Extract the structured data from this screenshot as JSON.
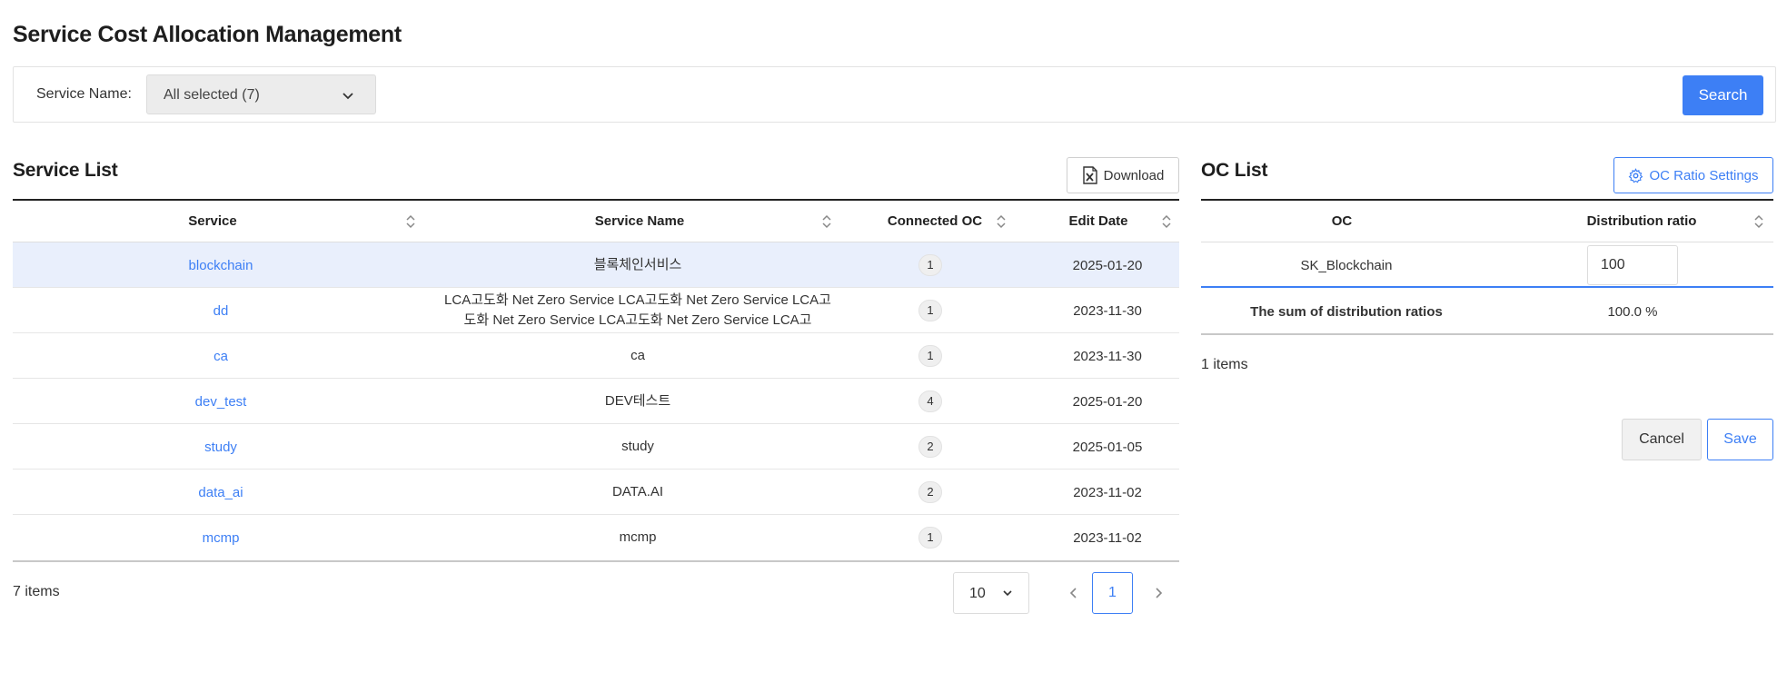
{
  "page": {
    "title": "Service Cost Allocation Management"
  },
  "filter": {
    "label": "Service Name:",
    "selected_value": "All selected (7)",
    "search_label": "Search"
  },
  "service_list": {
    "title": "Service List",
    "download_label": "Download",
    "columns": [
      "Service",
      "Service Name",
      "Connected OC",
      "Edit Date"
    ],
    "rows": [
      {
        "service": "blockchain",
        "name": "블록체인서비스",
        "connected_oc": "1",
        "edit_date": "2025-01-20",
        "selected": true
      },
      {
        "service": "dd",
        "name": "LCA고도화 Net Zero Service LCA고도화 Net Zero Service LCA고도화 Net Zero Service LCA고도화 Net Zero Service LCA고",
        "connected_oc": "1",
        "edit_date": "2023-11-30",
        "selected": false
      },
      {
        "service": "ca",
        "name": "ca",
        "connected_oc": "1",
        "edit_date": "2023-11-30",
        "selected": false
      },
      {
        "service": "dev_test",
        "name": "DEV테스트",
        "connected_oc": "4",
        "edit_date": "2025-01-20",
        "selected": false
      },
      {
        "service": "study",
        "name": "study",
        "connected_oc": "2",
        "edit_date": "2025-01-05",
        "selected": false
      },
      {
        "service": "data_ai",
        "name": "DATA.AI",
        "connected_oc": "2",
        "edit_date": "2023-11-02",
        "selected": false
      },
      {
        "service": "mcmp",
        "name": "mcmp",
        "connected_oc": "1",
        "edit_date": "2023-11-02",
        "selected": false
      }
    ],
    "items_count": "7 items",
    "page_size": "10",
    "current_page": "1"
  },
  "oc_list": {
    "title": "OC List",
    "settings_label": "OC Ratio Settings",
    "columns": [
      "OC",
      "Distribution ratio"
    ],
    "rows": [
      {
        "oc": "SK_Blockchain",
        "ratio": "100"
      }
    ],
    "sum_label": "The sum of distribution ratios",
    "sum_value": "100.0 %",
    "items_count": "1 items",
    "cancel_label": "Cancel",
    "save_label": "Save"
  },
  "colors": {
    "accent": "#3d7ff5",
    "selected_row": "#e9effc"
  }
}
